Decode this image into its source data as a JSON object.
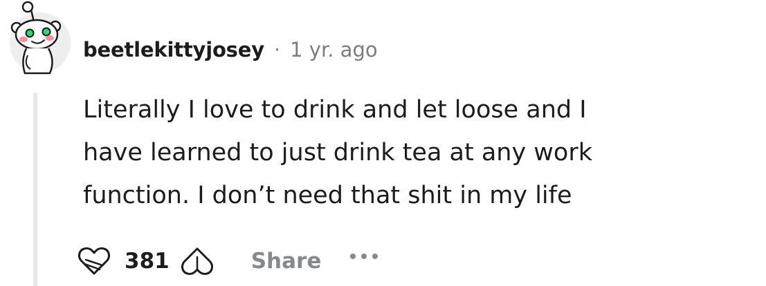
{
  "comment": {
    "author": "beetlekittyjosey",
    "separator": "·",
    "timestamp": "1 yr. ago",
    "body_lines": [
      "Literally I love to drink and let loose and I",
      "have learned to just drink tea at any work",
      "function. I don’t need that shit in my life"
    ],
    "score": "381",
    "share_label": "Share",
    "icons": {
      "avatar": "snoo-avatar-icon",
      "upvote": "upvote-heart-icon",
      "downvote": "downvote-heart-icon",
      "more": "more-options-icon"
    },
    "colors": {
      "text": "#1c1c1c",
      "muted": "#878a8c",
      "avatar_eye": "#2ed573",
      "avatar_cheek": "#ff8fa3"
    }
  }
}
